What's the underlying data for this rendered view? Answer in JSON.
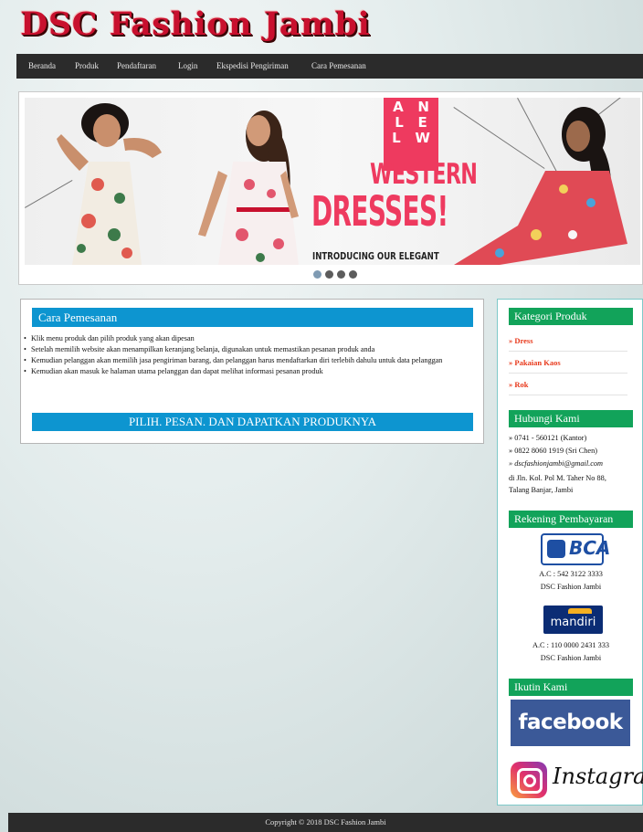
{
  "header": {
    "site_title": "DSC Fashion Jambi"
  },
  "nav": {
    "items": [
      {
        "label": "Beranda"
      },
      {
        "label": "Produk"
      },
      {
        "label": "Pendaftaran"
      },
      {
        "label": "Login"
      },
      {
        "label": "Ekspedisi Pengiriman"
      },
      {
        "label": "Cara Pemesanan"
      }
    ]
  },
  "slider": {
    "banner_top_letters": [
      "A",
      "N",
      "L",
      "E",
      "L",
      "W"
    ],
    "banner_western": "WESTERN",
    "banner_dresses": "DRESSES!",
    "banner_intro": "INTRODUCING OUR ELEGANT",
    "slide_count": 4,
    "active_slide": 1
  },
  "main": {
    "title": "Cara Pemesanan",
    "steps": [
      "Klik menu produk dan pilih produk yang akan dipesan",
      "Setelah memilih website akan menampilkan keranjang belanja, digunakan untuk memastikan pesanan produk anda",
      "Kemudian pelanggan akan memilih jasa pengiriman barang, dan pelanggan harus mendaftarkan diri terlebih dahulu untuk data pelanggan",
      "Kemudian akan masuk ke halaman utama pelanggan dan dapat melihat informasi pesanan produk"
    ],
    "cta": "PILIH. PESAN. DAN DAPATKAN PRODUKNYA"
  },
  "sidebar": {
    "kategori": {
      "title": "Kategori Produk",
      "items": [
        "» Dress",
        "» Pakaian Kaos",
        "» Rok"
      ]
    },
    "hubungi": {
      "title": "Hubungi Kami",
      "phone_office": "» 0741 - 560121 (Kantor)",
      "phone_mobile": "» 0822 8060 1919 (Sri Chen)",
      "email": "» dscfashionjambi@gmail.com",
      "address_1": "di Jln. Kol. Pol M. Taher No 88,",
      "address_2": "Talang Banjar, Jambi"
    },
    "rekening": {
      "title": "Rekening Pembayaran",
      "banks": [
        {
          "logo": "BCA",
          "account": "A.C : 542 3122 3333",
          "holder": "DSC Fashion Jambi"
        },
        {
          "logo": "mandiri",
          "account": "A.C : 110 0000 2431 333",
          "holder": "DSC Fashion Jambi"
        }
      ]
    },
    "ikuti": {
      "title": "Ikutin Kami",
      "facebook": "facebook",
      "instagram": "Instagram"
    }
  },
  "footer": {
    "copyright": "Copyright © 2018 DSC Fashion Jambi"
  },
  "colors": {
    "title_red": "#c8102e",
    "nav_bg": "#2b2b2b",
    "main_blue": "#0d95d0",
    "side_green": "#12a35a",
    "link_orange": "#e8381a",
    "banner_pink": "#ee3a5f"
  }
}
